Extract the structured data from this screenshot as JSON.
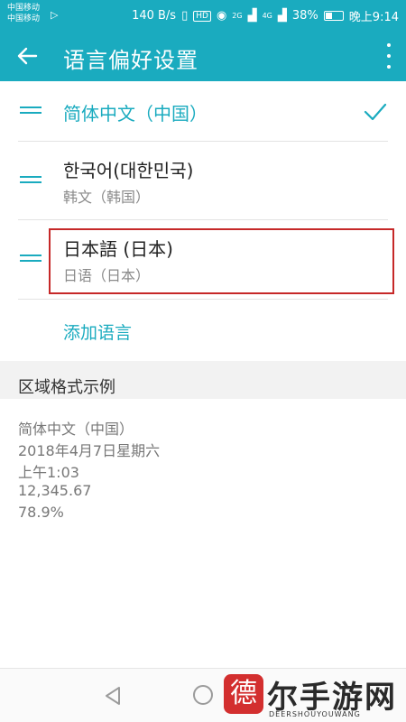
{
  "status_bar": {
    "carrier_1": "中国移动",
    "carrier_2": "中国移动",
    "net_speed": "140 B/s",
    "hd": "HD",
    "sig1": "2G",
    "sig2": "4G",
    "battery": "38%",
    "time": "晚上9:14"
  },
  "app_bar": {
    "title": "语言偏好设置"
  },
  "languages": [
    {
      "title": "简体中文（中国）",
      "subtitle": "",
      "selected": true
    },
    {
      "title": "한국어(대한민국)",
      "subtitle": "韩文（韩国）",
      "selected": false
    },
    {
      "title": "日本語 (日本)",
      "subtitle": "日语（日本）",
      "selected": false
    }
  ],
  "add_language": "添加语言",
  "region": {
    "header": "区域格式示例",
    "lines": [
      "简体中文（中国）",
      "2018年4月7日星期六",
      "上午1:03",
      "12,345.67",
      "78.9%"
    ]
  },
  "watermark": {
    "seal": "德",
    "text": "尔手游网",
    "sub": "DEERSHOUYOUWANG"
  },
  "colors": {
    "accent": "#1aabbf",
    "highlight": "#c62828"
  },
  "icons": [
    "back-arrow-icon",
    "more-vert-icon",
    "drag-handle-icon",
    "check-icon",
    "nav-back-icon",
    "nav-home-icon"
  ]
}
